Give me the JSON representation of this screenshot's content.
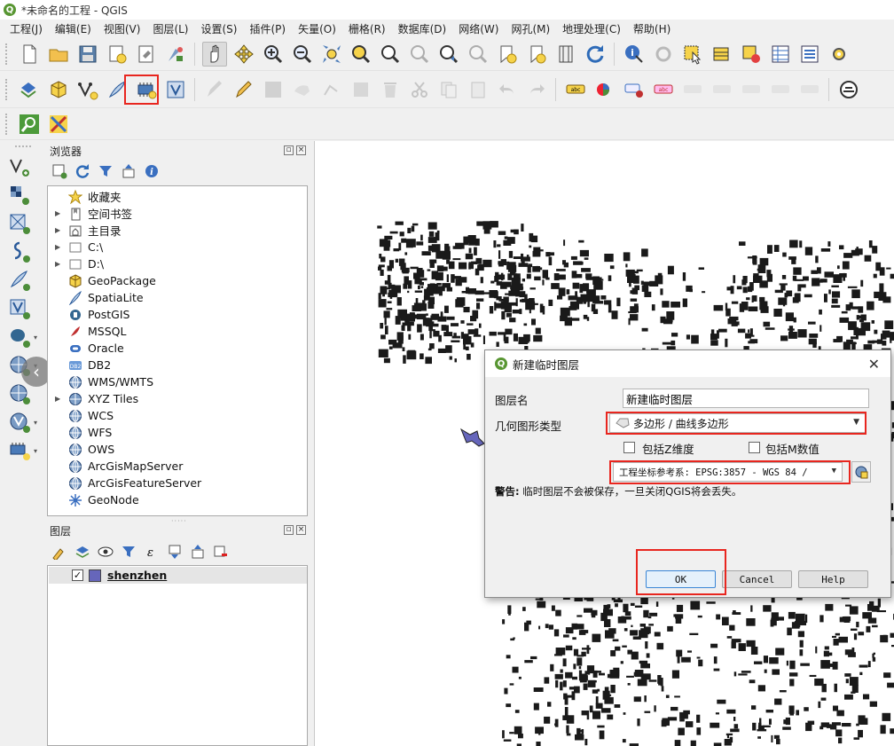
{
  "window": {
    "title": "*未命名的工程 - QGIS",
    "app_icon": "Q"
  },
  "menu": [
    "工程(J)",
    "编辑(E)",
    "视图(V)",
    "图层(L)",
    "设置(S)",
    "插件(P)",
    "矢量(O)",
    "栅格(R)",
    "数据库(D)",
    "网络(W)",
    "网孔(M)",
    "地理处理(C)",
    "帮助(H)"
  ],
  "browser": {
    "title": "浏览器",
    "items": [
      {
        "label": "收藏夹",
        "icon": "star-icon",
        "expandable": false
      },
      {
        "label": "空间书签",
        "icon": "bookmark-icon",
        "expandable": true
      },
      {
        "label": "主目录",
        "icon": "home-folder-icon",
        "expandable": true
      },
      {
        "label": "C:\\",
        "icon": "drive-icon",
        "expandable": true
      },
      {
        "label": "D:\\",
        "icon": "drive-icon",
        "expandable": true
      },
      {
        "label": "GeoPackage",
        "icon": "geopackage-icon",
        "expandable": false
      },
      {
        "label": "SpatiaLite",
        "icon": "spatialite-icon",
        "expandable": false
      },
      {
        "label": "PostGIS",
        "icon": "postgis-icon",
        "expandable": false
      },
      {
        "label": "MSSQL",
        "icon": "mssql-icon",
        "expandable": false
      },
      {
        "label": "Oracle",
        "icon": "oracle-icon",
        "expandable": false
      },
      {
        "label": "DB2",
        "icon": "db2-icon",
        "expandable": false
      },
      {
        "label": "WMS/WMTS",
        "icon": "globe-icon",
        "expandable": false
      },
      {
        "label": "XYZ Tiles",
        "icon": "xyz-tiles-icon",
        "expandable": true
      },
      {
        "label": "WCS",
        "icon": "globe-icon",
        "expandable": false
      },
      {
        "label": "WFS",
        "icon": "globe-icon",
        "expandable": false
      },
      {
        "label": "OWS",
        "icon": "globe-icon",
        "expandable": false
      },
      {
        "label": "ArcGisMapServer",
        "icon": "globe-icon",
        "expandable": false
      },
      {
        "label": "ArcGisFeatureServer",
        "icon": "globe-icon",
        "expandable": false
      },
      {
        "label": "GeoNode",
        "icon": "geonode-icon",
        "expandable": false
      }
    ]
  },
  "layers": {
    "title": "图层",
    "items": [
      {
        "label": "shenzhen",
        "checked": "✓",
        "color": "#6666bb"
      }
    ]
  },
  "dialog": {
    "title": "新建临时图层",
    "layer_name_label": "图层名",
    "layer_name_value": "新建临时图层",
    "geom_type_label": "几何图形类型",
    "geom_type_value": "多边形 / 曲线多边形",
    "include_z_label": "包括Z维度",
    "include_m_label": "包括M数值",
    "crs_value": "工程坐标参考系: EPSG:3857 - WGS 84 /",
    "warning_bold": "警告:",
    "warning_text": " 临时图层不会被保存，一旦关闭QGIS将会丢失。",
    "ok_label": "OK",
    "cancel_label": "Cancel",
    "help_label": "Help",
    "close_glyph": "✕"
  },
  "colors": {
    "highlight": "#e8261f",
    "qgis_green": "#589632",
    "layer_fill": "#6666bb"
  }
}
